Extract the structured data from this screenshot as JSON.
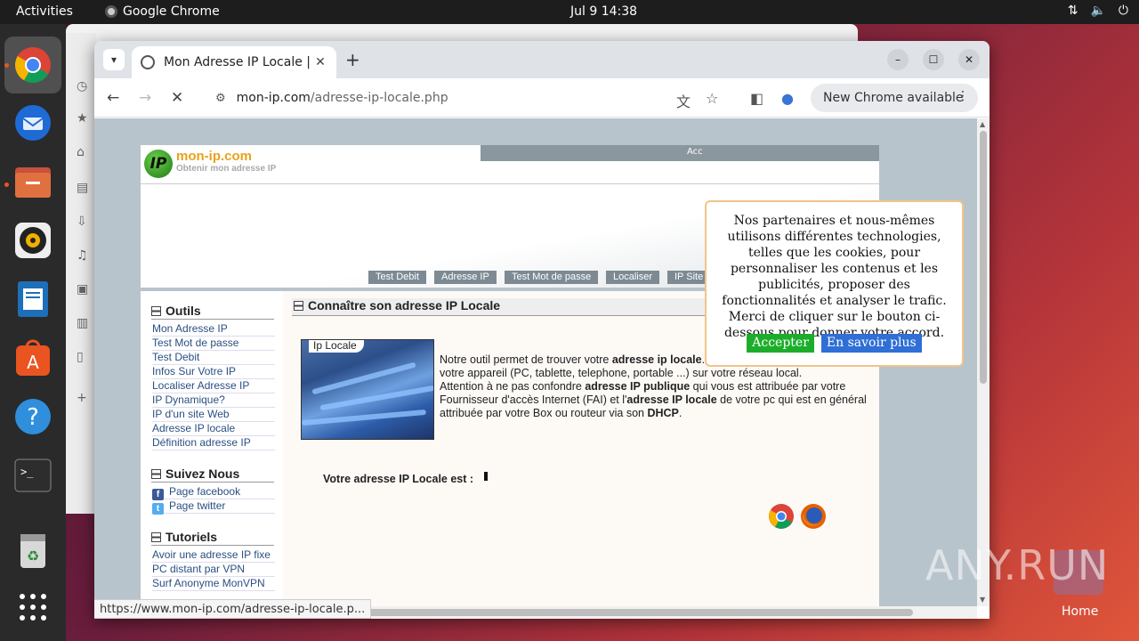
{
  "topbar": {
    "activities": "Activities",
    "app_name": "Google Chrome",
    "clock": "Jul 9  14:38"
  },
  "dock": {
    "items": [
      "chrome-icon",
      "thunderbird-icon",
      "files-icon",
      "rhythmbox-icon",
      "writer-icon",
      "app-center-icon",
      "help-icon",
      "terminal-icon",
      "trash-icon",
      "app-grid-icon"
    ]
  },
  "browser": {
    "tab_title": "Mon Adresse IP Locale | C",
    "url_domain": "mon-ip.com",
    "url_path": "/adresse-ip-locale.php",
    "new_chrome": "New Chrome available",
    "status_url": "https://www.mon-ip.com/adresse-ip-locale.p..."
  },
  "site": {
    "logo_mark": "IP",
    "logo_name": "mon-ip.com",
    "logo_sub": "Obtenir mon adresse IP",
    "strip_text": "Acc",
    "menu": [
      "Test Debit",
      "Adresse IP",
      "Test Mot de passe",
      "Localiser",
      "IP Site"
    ],
    "outils": {
      "title": "Outils",
      "links": [
        "Mon Adresse IP",
        "Test Mot de passe",
        "Test Debit",
        "Infos Sur Votre IP",
        "Localiser Adresse IP",
        "IP Dynamique?",
        "IP d'un site Web",
        "Adresse IP locale",
        "Définition adresse IP"
      ]
    },
    "suivez": {
      "title": "Suivez Nous",
      "links": [
        "Page facebook",
        "Page twitter"
      ]
    },
    "tutoriels": {
      "title": "Tutoriels",
      "links": [
        "Avoir une adresse IP fixe",
        "PC distant par VPN",
        "Surf Anonyme MonVPN"
      ]
    },
    "main_title": "Connaître son adresse IP Locale",
    "photo_label": "Ip Locale",
    "intro": {
      "p1a": "Notre outil permet de trouver votre ",
      "p1b": "adresse ip locale",
      "p1c": ". C'est ce qui permet d'identifier votre appareil (PC, tablette, telephone, portable ...) sur votre réseau local.",
      "p2a": "Attention à ne pas confondre ",
      "p2b": "adresse IP publique",
      "p2c": " qui vous est attribuée par votre Fournisseur d'accès Internet (FAI) et l'",
      "p2d": "adresse IP locale",
      "p2e": " de votre pc qui est en général attribuée par votre Box ou routeur via son ",
      "p2f": "DHCP",
      "p2g": "."
    },
    "ip_label": "Votre adresse IP Locale est :"
  },
  "cookie": {
    "text": "Nos partenaires et nous-mêmes utilisons différentes technologies, telles que les cookies, pour personnaliser les contenus et les publicités, proposer des fonctionnalités et analyser le trafic. Merci de cliquer sur le bouton ci-dessous pour donner votre accord.",
    "accept": "Accepter",
    "more": "En savoir plus"
  },
  "desktop": {
    "watermark": "ANY.RUN",
    "home_label": "Home"
  },
  "colors": {
    "accept_bg": "#1cae2b",
    "more_bg": "#2f6fd6",
    "link": "#2a4f82",
    "logo_accent": "#e8a21b"
  }
}
